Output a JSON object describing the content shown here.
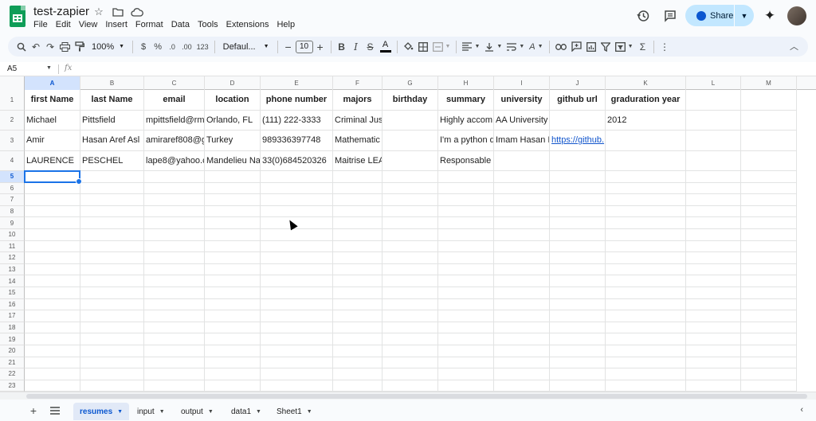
{
  "app": {
    "doc_title": "test-zapier",
    "menu": [
      "File",
      "Edit",
      "View",
      "Insert",
      "Format",
      "Data",
      "Tools",
      "Extensions",
      "Help"
    ],
    "share_label": "Share"
  },
  "toolbar": {
    "zoom": "100%",
    "currency": "$",
    "percent": "%",
    "decrease_decimal": ".0",
    "increase_decimal": ".00",
    "number_format": "123",
    "font_name": "Defaul...",
    "font_size": "10"
  },
  "formula_bar": {
    "cell_ref": "A5",
    "fx": "fx",
    "value": ""
  },
  "columns": [
    "A",
    "B",
    "C",
    "D",
    "E",
    "F",
    "G",
    "H",
    "I",
    "J",
    "K",
    "L",
    "M"
  ],
  "rows": [
    "1",
    "2",
    "3",
    "4",
    "5",
    "6",
    "7",
    "8",
    "9",
    "10",
    "11",
    "12",
    "13",
    "14",
    "15",
    "16",
    "17",
    "18",
    "19",
    "20",
    "21",
    "22",
    "23"
  ],
  "sheet": {
    "header": [
      "first Name",
      "last Name",
      "email",
      "location",
      "phone number",
      "majors",
      "birthday",
      "summary",
      "university",
      "github url",
      "graduration year",
      "",
      ""
    ],
    "data": [
      [
        "Michael",
        "Pittsfield",
        "mpittsfield@rm",
        "Orlando, FL",
        "(111) 222-3333",
        "Criminal Jus",
        "",
        "Highly accom",
        "AA University",
        "",
        "2012",
        "",
        ""
      ],
      [
        "Amir",
        "Hasan Aref Asl",
        "amiraref808@g",
        "Turkey",
        "989336397748",
        "Mathematic",
        "",
        "I'm a python d",
        "Imam Hasan I",
        "https://github.",
        "",
        "",
        ""
      ],
      [
        "LAURENCE",
        "PESCHEL",
        "lape8@yahoo.c",
        "Mandelieu Na",
        "33(0)684520326",
        "Maitrise LEA",
        "",
        "Responsable",
        "",
        "",
        "",
        "",
        ""
      ]
    ]
  },
  "active_cell": "A5",
  "sheet_tabs": [
    {
      "label": "resumes",
      "active": true
    },
    {
      "label": "input",
      "active": false
    },
    {
      "label": "output",
      "active": false
    },
    {
      "label": "data1",
      "active": false
    },
    {
      "label": "Sheet1",
      "active": false
    }
  ],
  "colors": {
    "accent": "#0b57d0",
    "share_bg": "#c2e7ff",
    "sheets_green": "#0f9d58",
    "link": "#1155cc"
  }
}
